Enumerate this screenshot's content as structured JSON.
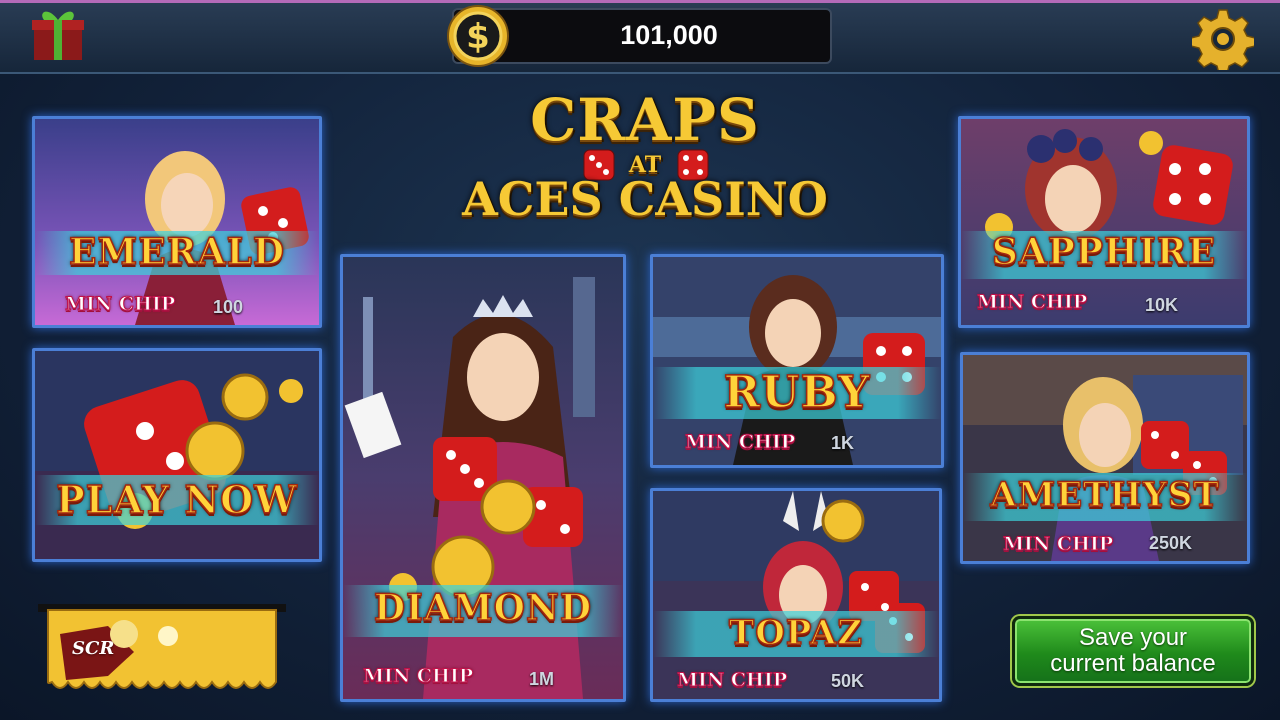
{
  "header": {
    "balance": "101,000",
    "gift_icon": "gift-box-icon",
    "coin_icon": "dollar-coin-icon",
    "settings_icon": "gear-icon"
  },
  "logo": {
    "line1": "CRAPS",
    "at": "AT",
    "line2": "ACES CASINO"
  },
  "rooms": {
    "emerald": {
      "name": "EMERALD",
      "min_chip_label": "MIN CHIP",
      "min_chip_value": "100"
    },
    "play_now": {
      "name": "PLAY NOW"
    },
    "diamond": {
      "name": "DIAMOND",
      "min_chip_label": "MIN CHIP",
      "min_chip_value": "1M"
    },
    "ruby": {
      "name": "RUBY",
      "min_chip_label": "MIN CHIP",
      "min_chip_value": "1K"
    },
    "topaz": {
      "name": "TOPAZ",
      "min_chip_label": "MIN CHIP",
      "min_chip_value": "50K"
    },
    "sapphire": {
      "name": "SAPPHIRE",
      "min_chip_label": "MIN CHIP",
      "min_chip_value": "10K"
    },
    "amethyst": {
      "name": "AMETHYST",
      "min_chip_label": "MIN CHIP",
      "min_chip_value": "250K"
    }
  },
  "scratch": {
    "label": "SCR"
  },
  "save_button": {
    "line1": "Save your",
    "line2": "current balance"
  },
  "colors": {
    "accent_gold": "#f6c935",
    "card_border": "#4b7fd6",
    "save_green": "#2a9a22"
  }
}
